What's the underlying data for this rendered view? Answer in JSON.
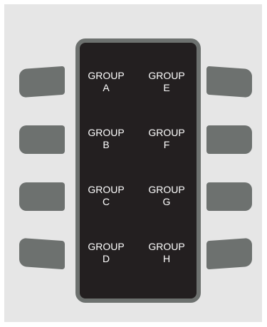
{
  "groups": {
    "a": "GROUP\nA",
    "b": "GROUP\nB",
    "c": "GROUP\nC",
    "d": "GROUP\nD",
    "e": "GROUP\nE",
    "f": "GROUP\nF",
    "g": "GROUP\nG",
    "h": "GROUP\nH"
  },
  "colors": {
    "panel": "#e6e6e6",
    "display": "#231f20",
    "bezel": "#6d716f",
    "key": "#6d716f",
    "text": "#ffffff"
  }
}
